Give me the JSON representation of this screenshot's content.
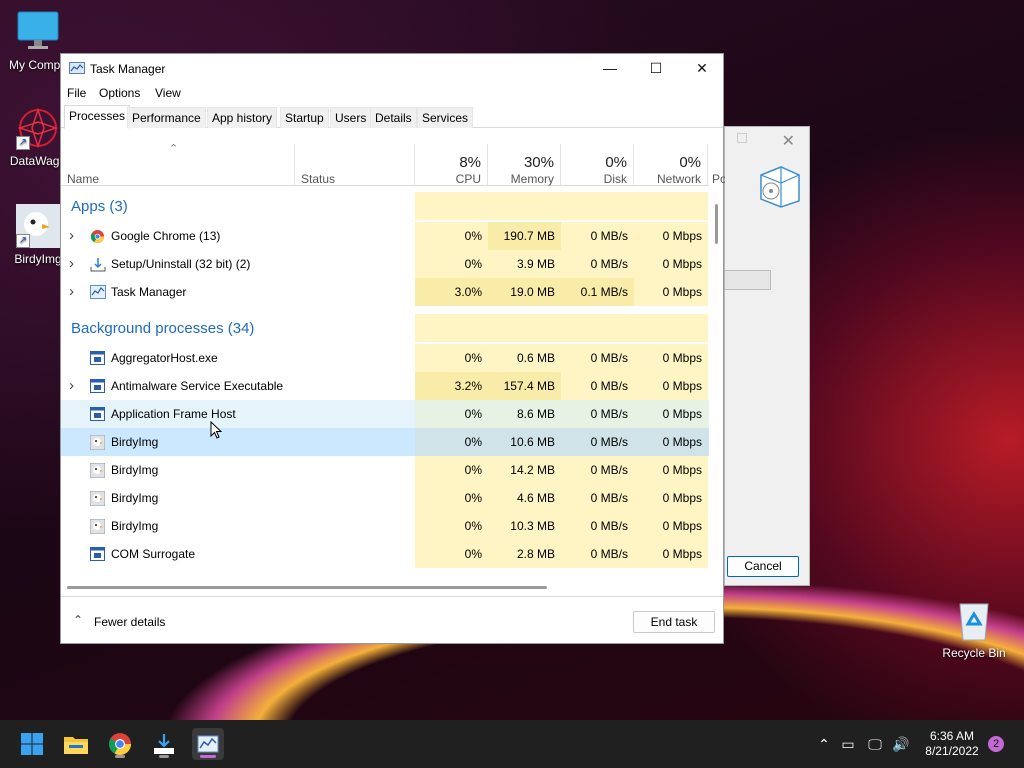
{
  "desktop": {
    "icons": [
      {
        "label": "My Compu",
        "icon": "monitor-icon"
      },
      {
        "label": "DataWago",
        "icon": "datawagon-app-icon"
      },
      {
        "label": "BirdyImg",
        "icon": "birdyimg-app-icon"
      },
      {
        "label": "Recycle Bin",
        "icon": "recycle-bin-icon"
      }
    ]
  },
  "bg_dialog": {
    "cancel_label": "Cancel"
  },
  "window": {
    "title": "Task Manager",
    "menu": [
      "File",
      "Options",
      "View"
    ],
    "tabs": [
      "Processes",
      "Performance",
      "App history",
      "Startup",
      "Users",
      "Details",
      "Services"
    ],
    "active_tab": "Processes",
    "columns": {
      "name": "Name",
      "status": "Status",
      "cpu": {
        "pct": "8%",
        "label": "CPU"
      },
      "memory": {
        "pct": "30%",
        "label": "Memory"
      },
      "disk": {
        "pct": "0%",
        "label": "Disk"
      },
      "network": {
        "pct": "0%",
        "label": "Network"
      },
      "power_partial": "Po"
    },
    "groups": {
      "apps": "Apps (3)",
      "background": "Background processes (34)"
    },
    "rows": [
      {
        "name": "Google Chrome (13)",
        "cpu": "0%",
        "memory": "190.7 MB",
        "disk": "0 MB/s",
        "network": "0 Mbps",
        "icon": "chrome-icon",
        "expandable": true
      },
      {
        "name": "Setup/Uninstall (32 bit) (2)",
        "cpu": "0%",
        "memory": "3.9 MB",
        "disk": "0 MB/s",
        "network": "0 Mbps",
        "icon": "setup-icon",
        "expandable": true
      },
      {
        "name": "Task Manager",
        "cpu": "3.0%",
        "memory": "19.0 MB",
        "disk": "0.1 MB/s",
        "network": "0 Mbps",
        "icon": "task-manager-icon",
        "expandable": true
      },
      {
        "name": "AggregatorHost.exe",
        "cpu": "0%",
        "memory": "0.6 MB",
        "disk": "0 MB/s",
        "network": "0 Mbps",
        "icon": "process-icon",
        "expandable": false
      },
      {
        "name": "Antimalware Service Executable",
        "cpu": "3.2%",
        "memory": "157.4 MB",
        "disk": "0 MB/s",
        "network": "0 Mbps",
        "icon": "process-icon",
        "expandable": true
      },
      {
        "name": "Application Frame Host",
        "cpu": "0%",
        "memory": "8.6 MB",
        "disk": "0 MB/s",
        "network": "0 Mbps",
        "icon": "process-icon",
        "expandable": false
      },
      {
        "name": "BirdyImg",
        "cpu": "0%",
        "memory": "10.6 MB",
        "disk": "0 MB/s",
        "network": "0 Mbps",
        "icon": "birdyimg-icon",
        "expandable": false
      },
      {
        "name": "BirdyImg",
        "cpu": "0%",
        "memory": "14.2 MB",
        "disk": "0 MB/s",
        "network": "0 Mbps",
        "icon": "birdyimg-icon",
        "expandable": false
      },
      {
        "name": "BirdyImg",
        "cpu": "0%",
        "memory": "4.6 MB",
        "disk": "0 MB/s",
        "network": "0 Mbps",
        "icon": "birdyimg-icon",
        "expandable": false
      },
      {
        "name": "BirdyImg",
        "cpu": "0%",
        "memory": "10.3 MB",
        "disk": "0 MB/s",
        "network": "0 Mbps",
        "icon": "birdyimg-icon",
        "expandable": false
      },
      {
        "name": "COM Surrogate",
        "cpu": "0%",
        "memory": "2.8 MB",
        "disk": "0 MB/s",
        "network": "0 Mbps",
        "icon": "process-icon",
        "expandable": false
      }
    ],
    "footer": {
      "fewer_details": "Fewer details",
      "end_task": "End task"
    }
  },
  "taskbar": {
    "clock_time": "6:36 AM",
    "clock_date": "8/21/2022",
    "notification_count": "2",
    "colors": {
      "accent": "#c36ad6",
      "taskbar": "#202020"
    }
  }
}
